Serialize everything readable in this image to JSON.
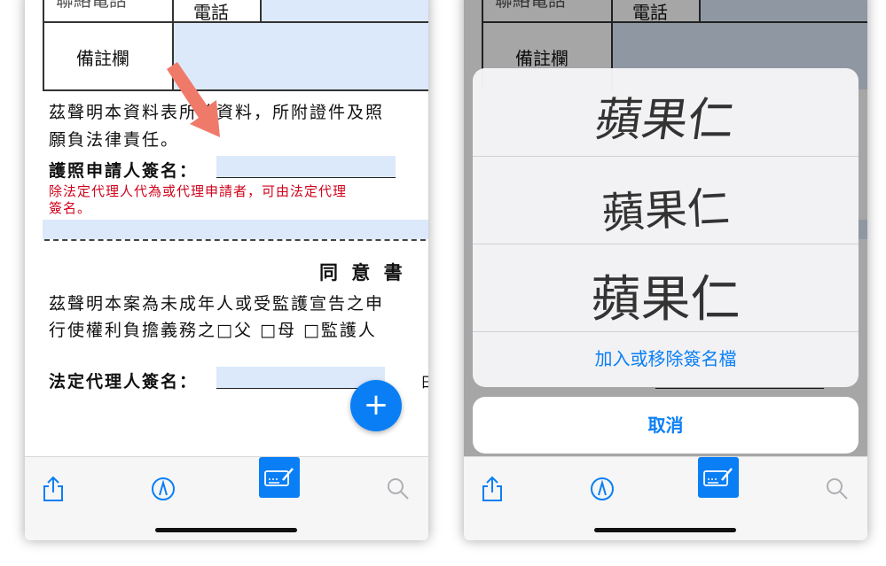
{
  "document": {
    "label_contact": "聯絡電話",
    "label_phone": "電話",
    "label_remarks": "備註欄",
    "declaration_line1": "茲聲明本資料表所填資料，所附證件及照",
    "declaration_line2": "願負法律責任。",
    "applicant_signature_label": "護照申請人簽名：",
    "red_note_line1": "除法定代理人代為或代理申請者，可由法定代理",
    "red_note_line2": "簽名。",
    "consent_title": "同 意 書",
    "consent_line1": "茲聲明本案為未成年人或受監護宣告之申",
    "consent_line2": "行使權利負擔義務之□父 □母 □監護人",
    "guardian_signature_label": "法定代理人簽名：",
    "date_fragment": "日"
  },
  "fab": {
    "label": "+"
  },
  "toolbar": {
    "share": "share-icon",
    "markup": "markup-pen-icon",
    "signature": "signature-icon",
    "search": "search-icon"
  },
  "signature_sheet": {
    "signatures": [
      "蘋果仁",
      "蘋果仁",
      "蘋果仁"
    ],
    "manage_label": "加入或移除簽名檔",
    "cancel_label": "取消"
  },
  "colors": {
    "accent": "#0a7ff5",
    "field_blue": "#dce9fb",
    "arrow": "#f07a6a",
    "note_red": "#d0021b"
  }
}
